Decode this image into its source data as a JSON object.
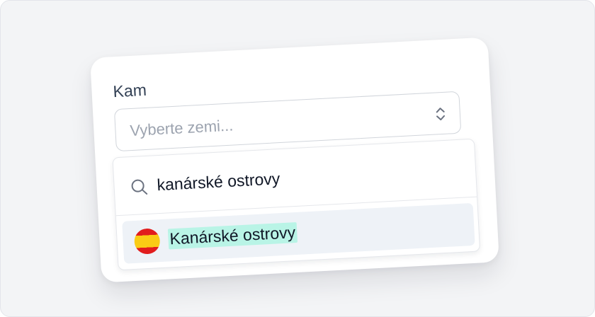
{
  "field": {
    "label": "Kam",
    "placeholder": "Vyberte zemi..."
  },
  "dropdown": {
    "search_value": "kanárské ostrovy",
    "options": [
      {
        "label": "Kanárské ostrovy",
        "flag_icon": "spain-flag-icon",
        "highlighted": true
      }
    ]
  },
  "colors": {
    "background": "#f3f4f6",
    "highlight": "#b9f4e6",
    "flag_red": "#e11d1d",
    "flag_yellow": "#facc15"
  }
}
